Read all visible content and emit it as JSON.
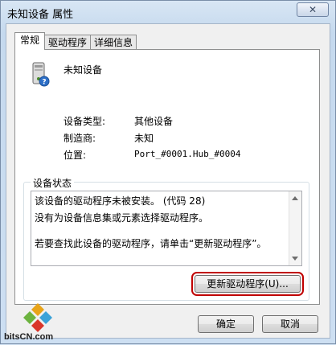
{
  "window": {
    "title": "未知设备 属性",
    "close_label": "✕"
  },
  "tabs": [
    {
      "label": "常规",
      "active": true
    },
    {
      "label": "驱动程序",
      "active": false
    },
    {
      "label": "详细信息",
      "active": false
    }
  ],
  "device": {
    "name": "未知设备",
    "properties": [
      {
        "label": "设备类型:",
        "value": "其他设备"
      },
      {
        "label": "制造商:",
        "value": "未知"
      },
      {
        "label": "位置:",
        "value": "Port_#0001.Hub_#0004"
      }
    ]
  },
  "status": {
    "group_label": "设备状态",
    "lines": [
      "该设备的驱动程序未被安装。 (代码 28)",
      "没有为设备信息集或元素选择驱动程序。",
      "",
      "若要查找此设备的驱动程序，请单击“更新驱动程序”。"
    ],
    "update_button": "更新驱动程序(U)..."
  },
  "buttons": {
    "ok": "确定",
    "cancel": "取消"
  },
  "watermark": {
    "site": "bitsCN.com"
  }
}
